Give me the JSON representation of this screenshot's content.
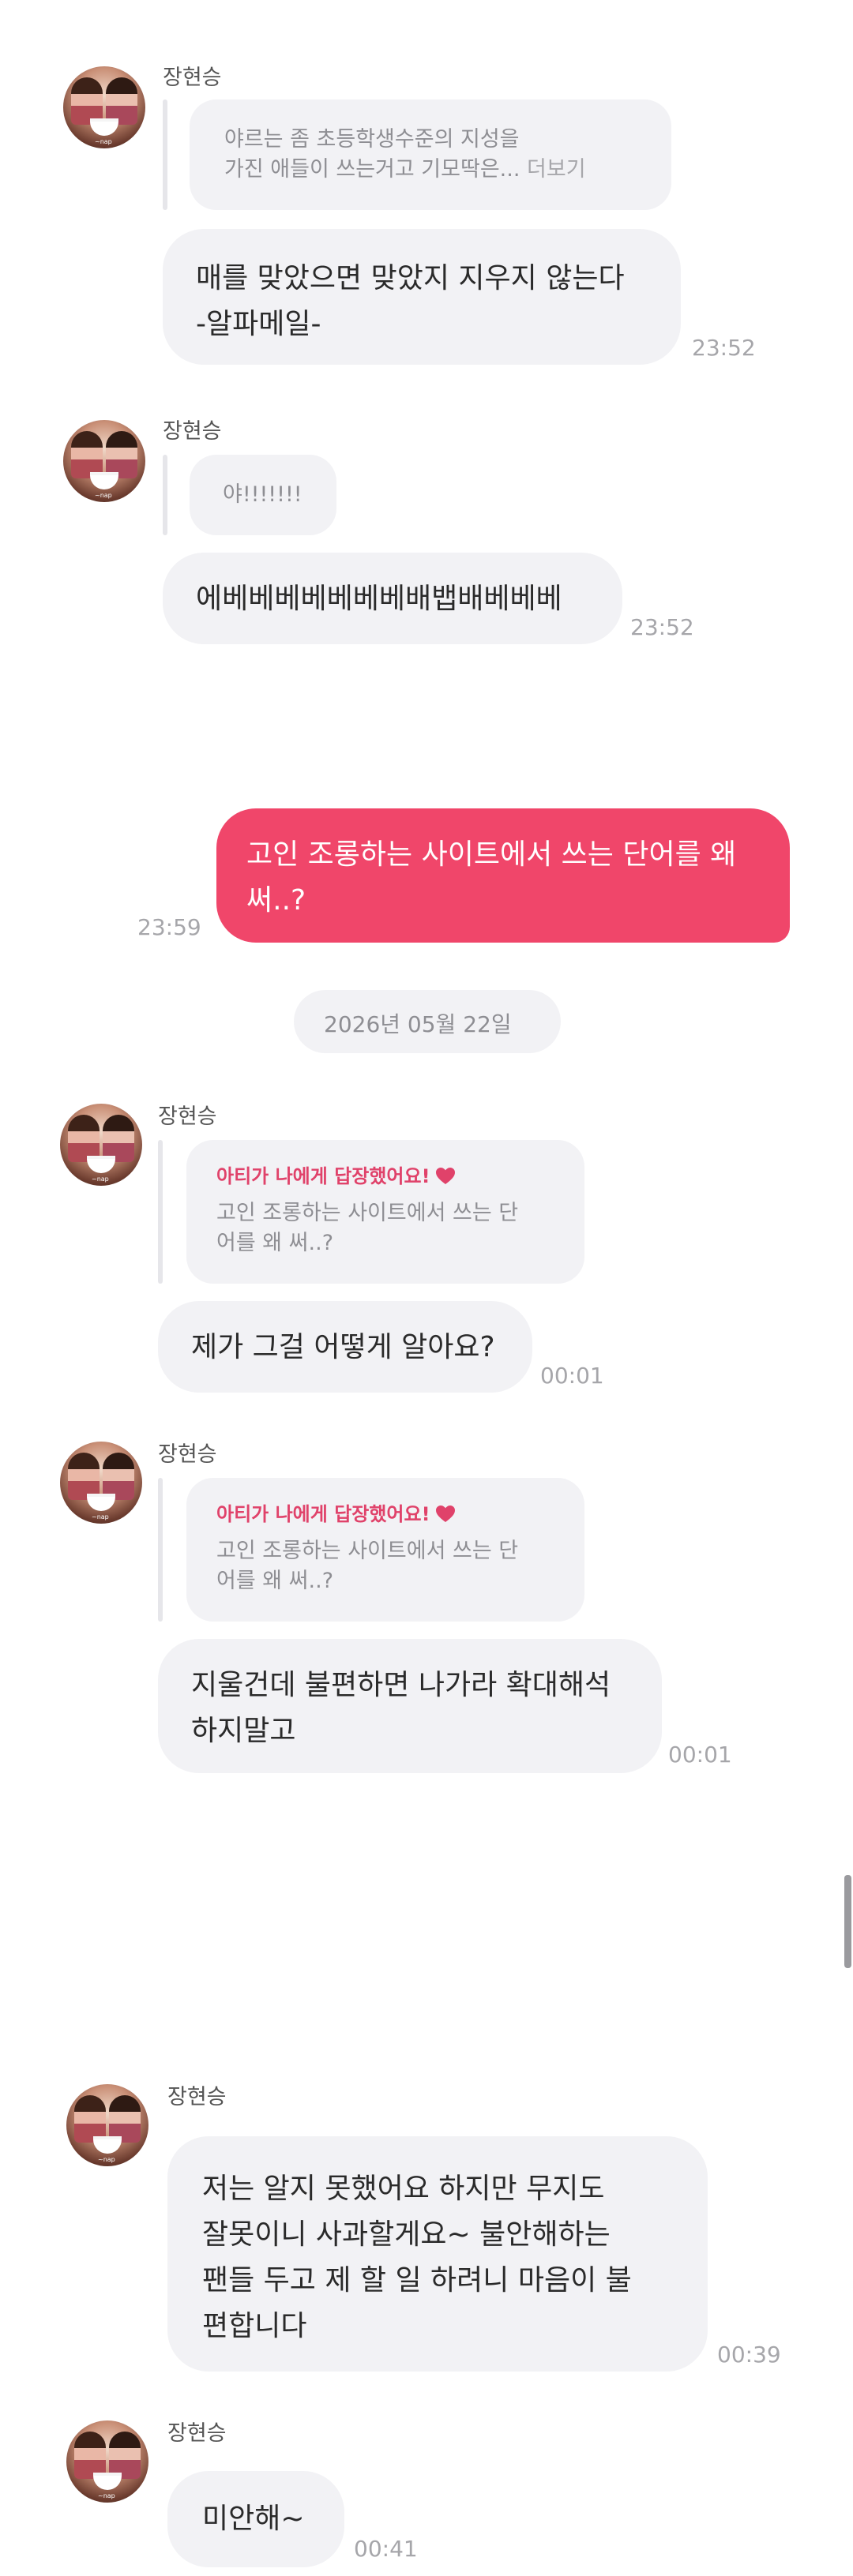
{
  "theme": {
    "accent": "#f0466a",
    "bubble_bg": "#f2f2f5",
    "text": "#2a2a2a",
    "muted": "#8e8e93"
  },
  "messages": [
    {
      "sender": "장현승",
      "reply_lines": [
        "야르는 좀 초등학생수준의 지성을",
        "가진 애들이 쓰는거고 기모딱은..."
      ],
      "more": "더보기",
      "text_lines": [
        "매를 맞았으면 맞았지 지우지 않는다",
        "-알파메일-"
      ],
      "time": "23:52"
    },
    {
      "sender": "장현승",
      "reply_lines": [
        "야!!!!!!!"
      ],
      "text_lines": [
        "에베베베베베베베배뱁배베베베"
      ],
      "time": "23:52"
    },
    {
      "mine": true,
      "text_lines": [
        "고인 조롱하는 사이트에서 쓰는 단어를 왜",
        "써..?"
      ],
      "time": "23:59"
    },
    {
      "sender": "장현승",
      "reply_head": "아티가 나에게 답장했어요!",
      "reply_lines": [
        "고인 조롱하는 사이트에서 쓰는 단",
        "어를 왜 써..?"
      ],
      "text_lines": [
        "제가 그걸 어떻게 알아요?"
      ],
      "time": "00:01"
    },
    {
      "sender": "장현승",
      "reply_head": "아티가 나에게 답장했어요!",
      "reply_lines": [
        "고인 조롱하는 사이트에서 쓰는 단",
        "어를 왜 써..?"
      ],
      "text_lines": [
        "지울건데 불편하면 나가라 확대해석",
        "하지말고"
      ],
      "time": "00:01"
    },
    {
      "sender": "장현승",
      "text_lines": [
        "저는 알지 못했어요 하지만 무지도",
        "잘못이니 사과할게요~ 불안해하는",
        "팬들 두고 제 할 일 하려니 마음이 불",
        "편합니다"
      ],
      "time": "00:39"
    },
    {
      "sender": "장현승",
      "text_lines": [
        "미안해~"
      ],
      "time": "00:41"
    }
  ],
  "date_separator": "2026년 05월 22일",
  "avatar_caption": "~nap"
}
